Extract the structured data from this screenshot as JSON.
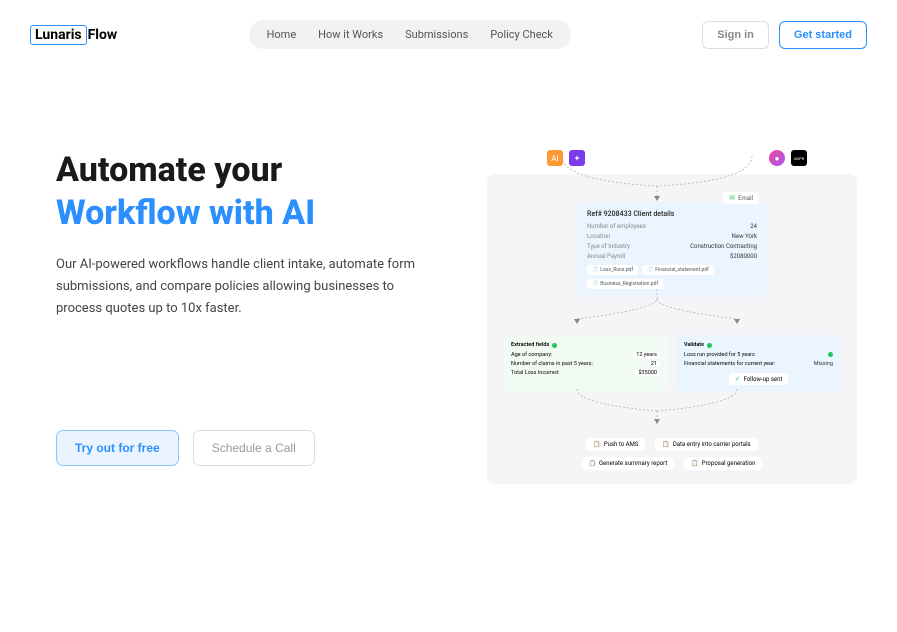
{
  "logo": {
    "boxed": "Lunaris",
    "rest": "Flow"
  },
  "nav": [
    "Home",
    "How it Works",
    "Submissions",
    "Policy Check"
  ],
  "actions": {
    "signin": "Sign in",
    "getstarted": "Get started"
  },
  "hero": {
    "title_line1": "Automate your",
    "title_line2": "Workflow with AI",
    "desc": "Our AI-powered workflows handle client intake, automate form submissions, and compare policies allowing businesses to process quotes up to 10x faster.",
    "btn_try": "Try out for free",
    "btn_call": "Schedule a Call"
  },
  "diagram": {
    "email_badge": "Email",
    "client": {
      "title": "Ref# 9208433 Client details",
      "rows": [
        [
          "Number of employees",
          "24"
        ],
        [
          "Location",
          "New York"
        ],
        [
          "Type of Industry",
          "Construction Contracting"
        ],
        [
          "Annual Payroll",
          "$2080000"
        ]
      ],
      "files": [
        "Loss_Runs.pdf",
        "Financial_statement.pdf",
        "Business_Registration.pdf"
      ]
    },
    "extracted": {
      "title": "Extracted fields",
      "rows": [
        [
          "Age of company:",
          "12 years"
        ],
        [
          "Number of claims in past 5 years:",
          "21"
        ],
        [
          "Total Loss Incurred:",
          "$35000"
        ]
      ]
    },
    "validate": {
      "title": "Validate",
      "rows": [
        [
          "Loss run provided for 5 years",
          ""
        ],
        [
          "Financial statements for current year:",
          "Missing"
        ]
      ],
      "followup": "Follow-up sent"
    },
    "actions_row1": [
      "Push to AMS",
      "Data entry into carrier portals"
    ],
    "actions_row2": [
      "Generate summary report",
      "Proposal generation"
    ]
  }
}
